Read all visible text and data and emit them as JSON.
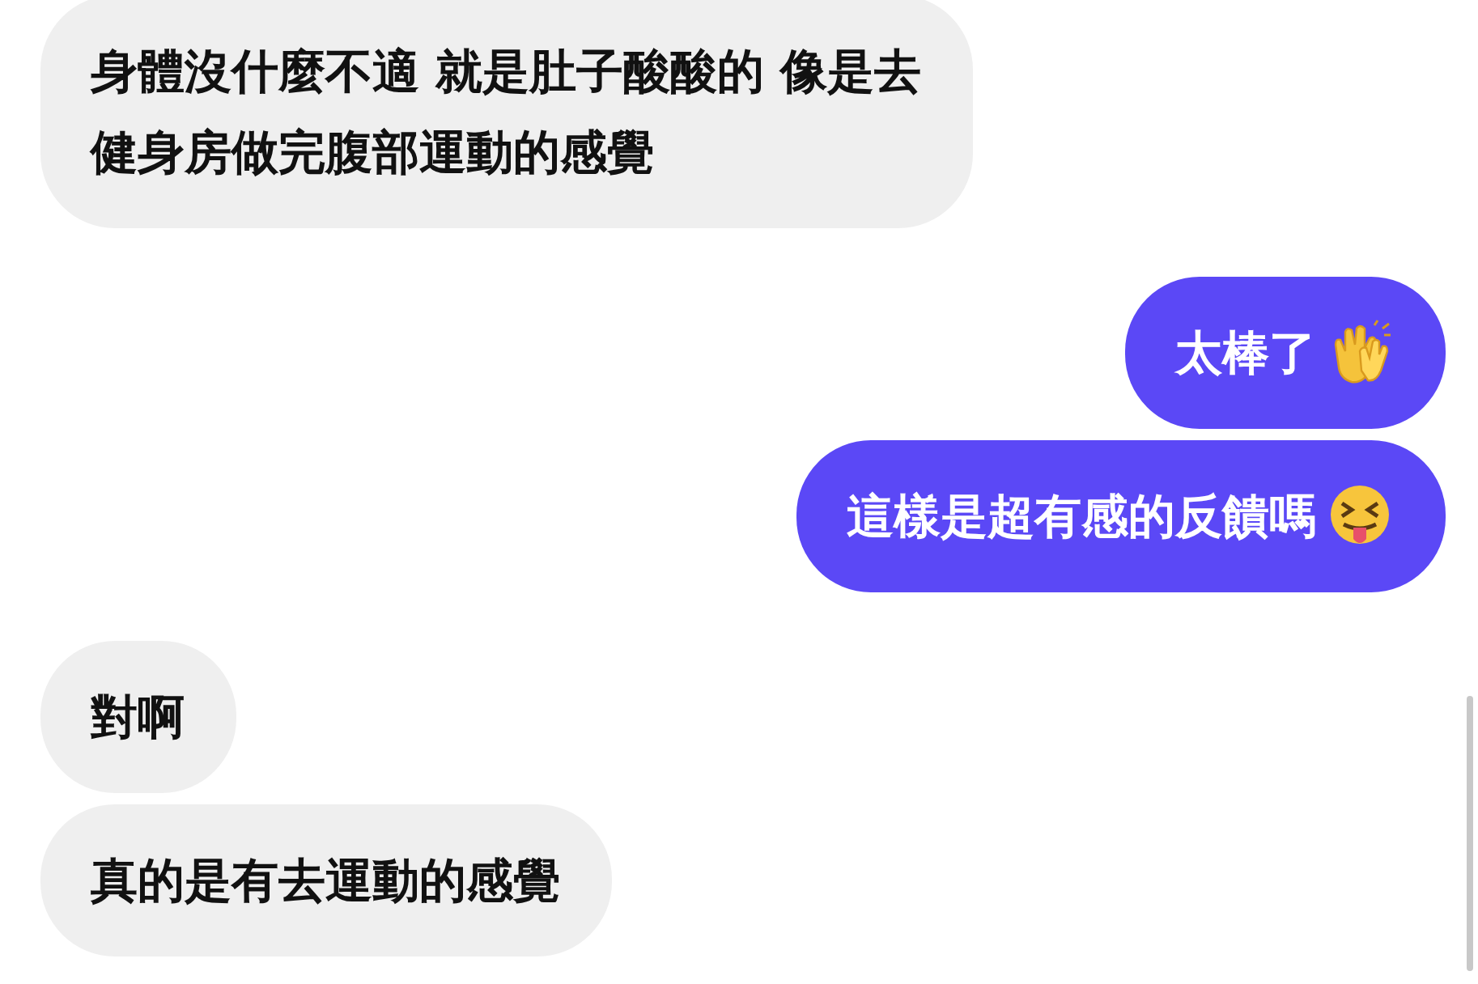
{
  "messages": [
    {
      "kind": "incoming",
      "lines": [
        "身體沒什麼不適 就是肚子酸酸的 像是去",
        "健身房做完腹部運動的感覺"
      ]
    },
    {
      "kind": "outgoing",
      "lines": [
        "太棒了"
      ],
      "emoji": {
        "kind": "clap"
      }
    },
    {
      "kind": "outgoing",
      "lines": [
        "這樣是超有感的反饋嗎"
      ],
      "emoji": {
        "kind": "tongue"
      }
    },
    {
      "kind": "incoming",
      "lines": [
        "對啊"
      ]
    },
    {
      "kind": "incoming",
      "lines": [
        "真的是有去運動的感覺"
      ]
    }
  ]
}
